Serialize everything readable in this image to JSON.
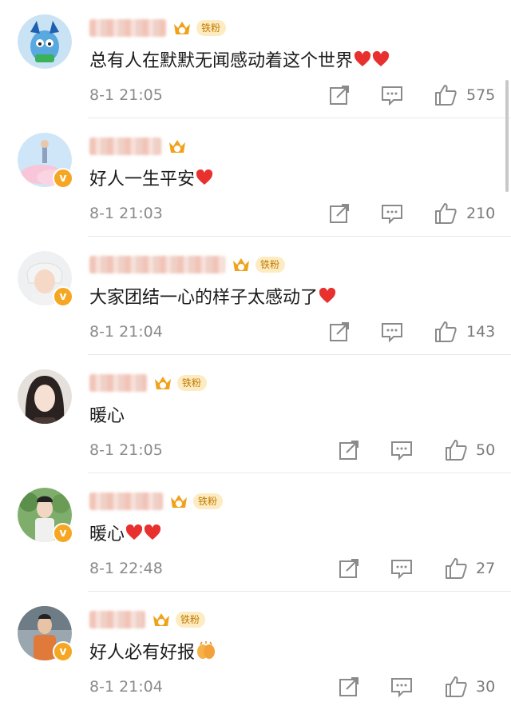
{
  "labels": {
    "fan_badge": "铁粉"
  },
  "comments": [
    {
      "text": "总有人在默默无闻感动着这个世界",
      "hearts": 2,
      "time": "8-1 21:05",
      "likes": "575",
      "verified": false,
      "fan": true
    },
    {
      "text": "好人一生平安",
      "hearts": 1,
      "time": "8-1 21:03",
      "likes": "210",
      "verified": true,
      "fan": false
    },
    {
      "text": "大家团结一心的样子太感动了",
      "hearts": 1,
      "time": "8-1 21:04",
      "likes": "143",
      "verified": true,
      "fan": true
    },
    {
      "text": "暖心",
      "hearts": 0,
      "time": "8-1 21:05",
      "likes": "50",
      "verified": false,
      "fan": true
    },
    {
      "text": "暖心",
      "hearts": 2,
      "time": "8-1 22:48",
      "likes": "27",
      "verified": true,
      "fan": true
    },
    {
      "text": "好人必有好报",
      "hearts": 0,
      "emoji": "clap-hands-icon",
      "time": "8-1 21:04",
      "likes": "30",
      "verified": true,
      "fan": true
    }
  ],
  "colors": {
    "heart": "#e8312f",
    "verified": "#f5a623",
    "fan_badge_bg": "#fdecc2",
    "icon": "#8a8a8a"
  }
}
